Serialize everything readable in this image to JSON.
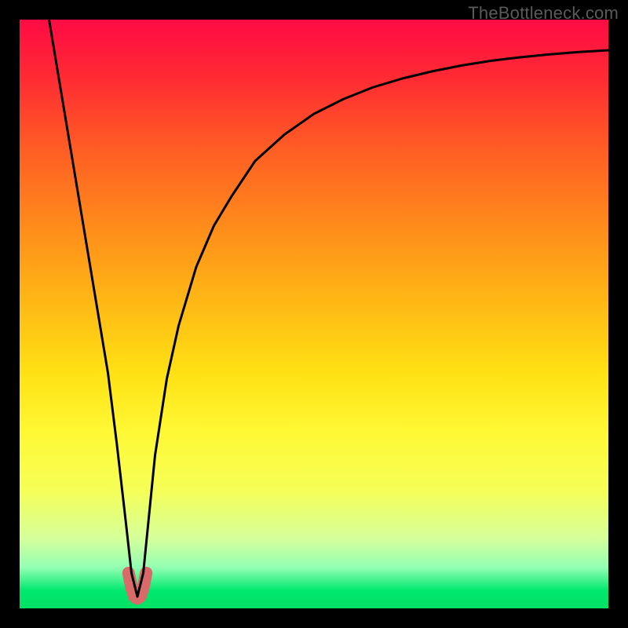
{
  "watermark": "TheBottleneck.com",
  "chart_data": {
    "type": "line",
    "title": "",
    "xlabel": "",
    "ylabel": "",
    "xlim": [
      0,
      100
    ],
    "ylim": [
      0,
      100
    ],
    "series": [
      {
        "name": "curve",
        "x": [
          5,
          7,
          9,
          11,
          13,
          15,
          16.5,
          18,
          19,
          20,
          21,
          22,
          23,
          25,
          27,
          30,
          33,
          36,
          40,
          45,
          50,
          55,
          60,
          65,
          70,
          75,
          80,
          85,
          90,
          95,
          100
        ],
        "values": [
          100,
          88,
          76,
          64,
          52,
          40,
          28,
          15,
          6,
          2,
          6,
          16,
          26,
          39,
          48,
          58,
          65,
          70,
          76,
          80.5,
          84,
          86.5,
          88.5,
          90,
          91.2,
          92.2,
          93,
          93.6,
          94.1,
          94.5,
          94.8
        ]
      },
      {
        "name": "marker-band",
        "x": [
          18.5,
          19,
          19.5,
          20,
          20.5,
          21,
          21.5
        ],
        "values": [
          6,
          3.5,
          2,
          1.7,
          2,
          3.5,
          6
        ]
      }
    ],
    "colors": {
      "curve": "#000000",
      "marker": "#d86a6a"
    }
  }
}
